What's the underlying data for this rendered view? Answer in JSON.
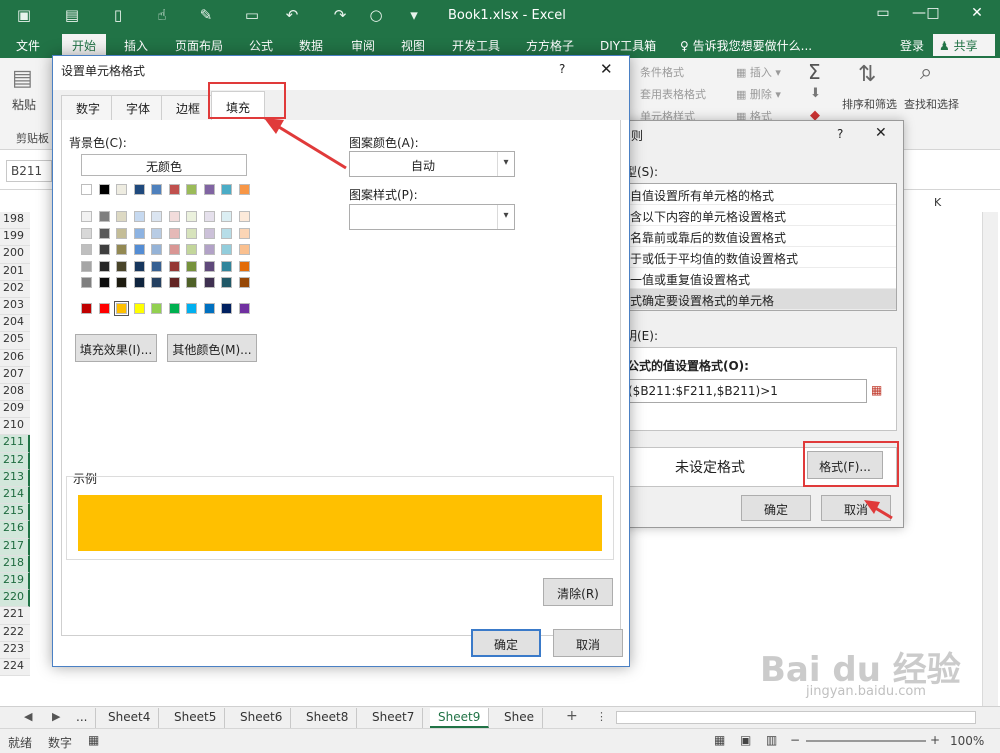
{
  "window": {
    "title": "Book1.xlsx - Excel",
    "controls": [
      "▭",
      "—",
      "□",
      "✕"
    ]
  },
  "menu": {
    "file": "文件",
    "tabs": [
      "开始",
      "插入",
      "页面布局",
      "公式",
      "数据",
      "审阅",
      "视图",
      "开发工具",
      "方方格子",
      "DIY工具箱"
    ],
    "tellme": "告诉我您想要做什么...",
    "login": "登录",
    "share": "共享"
  },
  "ribbon": {
    "paste": "粘贴",
    "clipboard_group": "剪贴板",
    "conditional_format": "条件格式",
    "table_format": "套用表格格式",
    "cell_style": "单元格样式",
    "insert": "插入",
    "delete": "删除",
    "format": "格式",
    "sort_filter": "排序和筛选",
    "find_select": "查找和选择"
  },
  "namebox": "B211",
  "sheet": {
    "rows": [
      "198",
      "199",
      "200",
      "201",
      "202",
      "203",
      "204",
      "205",
      "206",
      "207",
      "208",
      "209",
      "210",
      "211",
      "212",
      "213",
      "214",
      "215",
      "216",
      "217",
      "218",
      "219",
      "220",
      "221",
      "222",
      "223",
      "224"
    ],
    "selected_rows": [
      "211",
      "212",
      "213",
      "214",
      "215",
      "216",
      "217",
      "218",
      "219",
      "220"
    ],
    "visible_column": "K"
  },
  "sheet_tabs": {
    "tabs": [
      "Sheet4",
      "Sheet5",
      "Sheet6",
      "Sheet8",
      "Sheet7",
      "Sheet9",
      "Shee"
    ],
    "active": "Sheet9",
    "more": "...",
    "add": "+"
  },
  "status": {
    "ready": "就绪",
    "mode": "数字",
    "zoom": "100%"
  },
  "rule_dialog": {
    "title": "则",
    "rule_type_label": "型(S):",
    "rule_types": [
      "自值设置所有单元格的格式",
      "含以下内容的单元格设置格式",
      "名靠前或靠后的数值设置格式",
      "于或低于平均值的数值设置格式",
      "一值或重复值设置格式",
      "式确定要设置格式的单元格"
    ],
    "selected_index": 5,
    "description_label": "明(E):",
    "formula_label": "公式的值设置格式(O):",
    "formula": "($B211:$F211,$B211)>1",
    "preview_text": "未设定格式",
    "format_button": "格式(F)...",
    "ok": "确定",
    "cancel": "取消"
  },
  "format_dialog": {
    "title": "设置单元格格式",
    "help": "?",
    "close": "✕",
    "tabs": [
      "数字",
      "字体",
      "边框",
      "填充"
    ],
    "active_tab": "填充",
    "bg_color_label": "背景色(C):",
    "no_color": "无颜色",
    "pattern_color_label": "图案颜色(A):",
    "pattern_color_value": "自动",
    "pattern_style_label": "图案样式(P):",
    "pattern_style_value": "",
    "fill_effects": "填充效果(I)...",
    "more_colors": "其他颜色(M)...",
    "sample_label": "示例",
    "sample_color": "#ffc000",
    "clear": "清除(R)",
    "ok": "确定",
    "cancel": "取消",
    "theme_row": [
      "#ffffff",
      "#000000",
      "#eeece1",
      "#1f497d",
      "#4f81bd",
      "#c0504d",
      "#9bbb59",
      "#8064a2",
      "#4bacc6",
      "#f79646"
    ],
    "shade_rows": [
      [
        "#f2f2f2",
        "#7f7f7f",
        "#ddd9c3",
        "#c6d9f0",
        "#dbe5f1",
        "#f2dcdb",
        "#ebf1dd",
        "#e5e0ec",
        "#dbeef3",
        "#fdeada"
      ],
      [
        "#d8d8d8",
        "#595959",
        "#c4bd97",
        "#8db3e2",
        "#b8cce4",
        "#e5b9b7",
        "#d7e3bc",
        "#ccc1d9",
        "#b7dde8",
        "#fbd5b5"
      ],
      [
        "#bfbfbf",
        "#3f3f3f",
        "#938953",
        "#548dd4",
        "#95b3d7",
        "#d99694",
        "#c3d69b",
        "#b2a2c7",
        "#92cddc",
        "#fac08f"
      ],
      [
        "#a5a5a5",
        "#262626",
        "#494429",
        "#17365d",
        "#366092",
        "#953734",
        "#76923c",
        "#5f497a",
        "#31859b",
        "#e36c09"
      ],
      [
        "#7f7f7f",
        "#0c0c0c",
        "#1d1b10",
        "#0f243e",
        "#244061",
        "#632423",
        "#4f6128",
        "#3f3151",
        "#205867",
        "#974806"
      ]
    ],
    "standard_row": [
      "#c00000",
      "#ff0000",
      "#ffc000",
      "#ffff00",
      "#92d050",
      "#00b050",
      "#00b0f0",
      "#0070c0",
      "#002060",
      "#7030a0"
    ],
    "selected_standard_index": 2
  },
  "watermark": {
    "brand": "Bai du 经验",
    "url": "jingyan.baidu.com"
  }
}
